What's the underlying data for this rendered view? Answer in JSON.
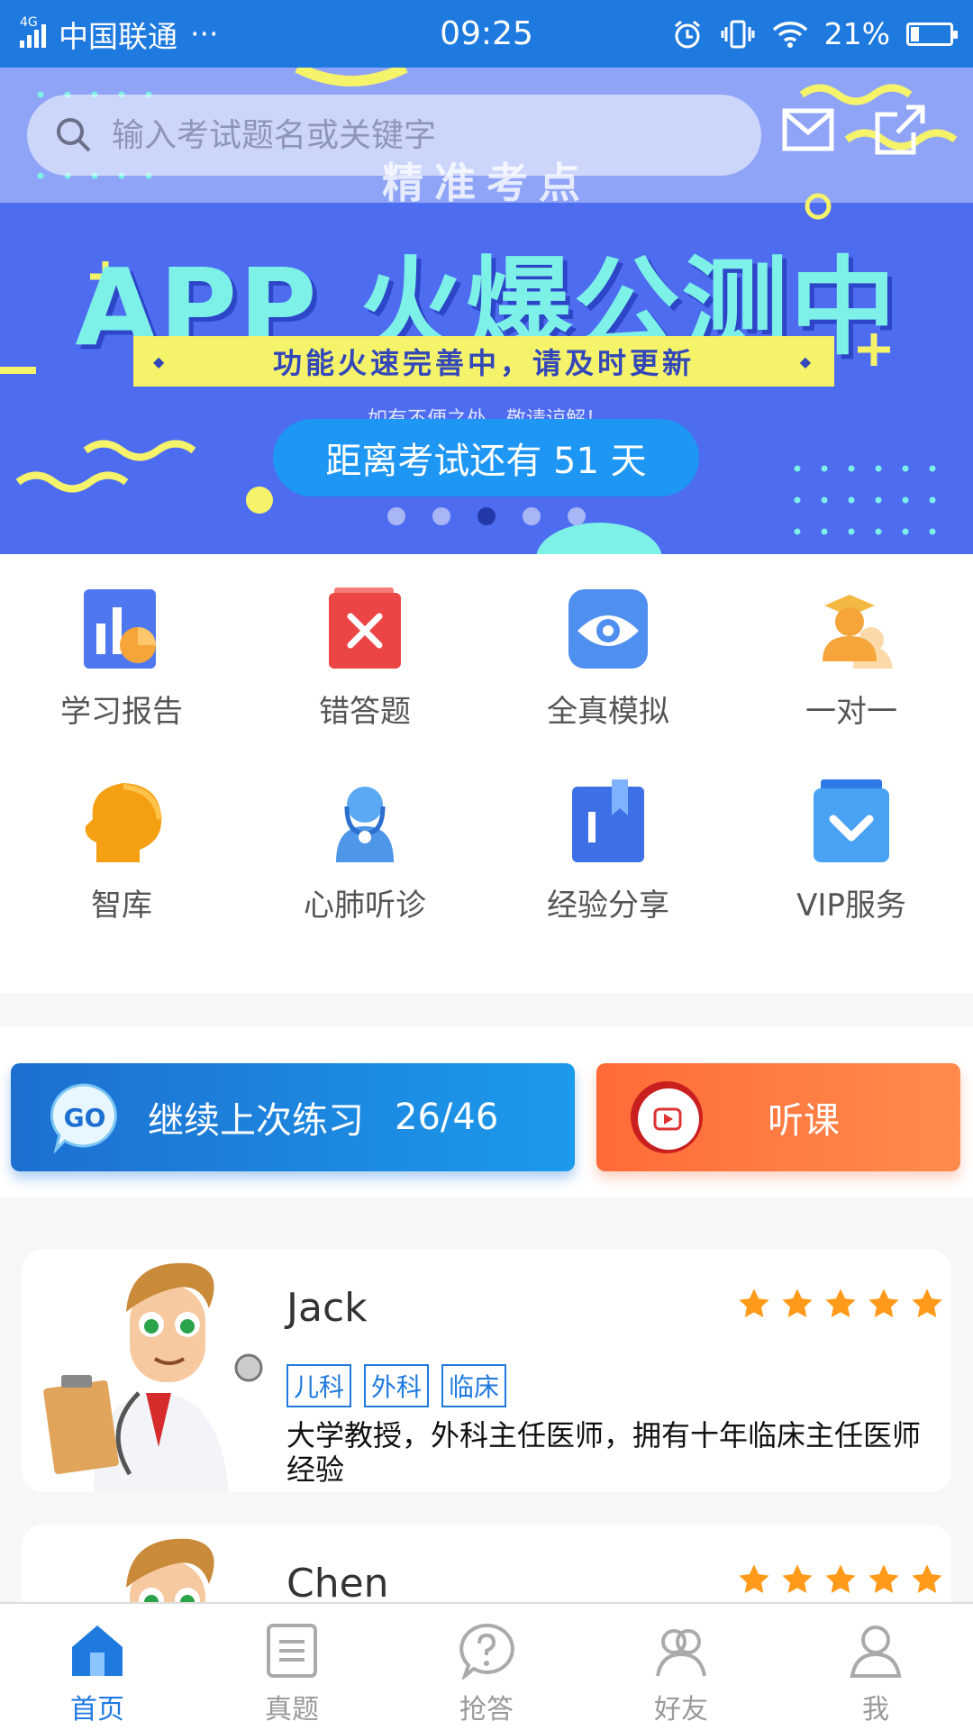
{
  "status_bar": {
    "network": "4G",
    "carrier": "中国联通",
    "more": "···",
    "time": "09:25",
    "battery": "21%",
    "battery_level": 0.21
  },
  "banner": {
    "search_placeholder": "输入考试题名或关键字",
    "top_text": "精准考点",
    "title": "APP 火爆公测中",
    "strip_text": "功能火速完善中，请及时更新",
    "note": "如有不便之处，敬请谅解！",
    "countdown": "距离考试还有  51  天",
    "slide_count": 5,
    "active_slide": 3
  },
  "features": [
    {
      "label": "学习报告",
      "icon": "report-icon"
    },
    {
      "label": "错答题",
      "icon": "wrong-answer-icon"
    },
    {
      "label": "全真模拟",
      "icon": "eye-icon"
    },
    {
      "label": "一对一",
      "icon": "tutor-icon"
    },
    {
      "label": "智库",
      "icon": "brain-icon"
    },
    {
      "label": "心肺听诊",
      "icon": "auscultation-icon"
    },
    {
      "label": "经验分享",
      "icon": "bookmark-icon"
    },
    {
      "label": "VIP服务",
      "icon": "vip-icon"
    }
  ],
  "actions": {
    "continue_label": "继续上次练习",
    "continue_progress": "26/46",
    "go_badge": "GO",
    "listen_label": "听课"
  },
  "teachers": [
    {
      "name": "Jack",
      "rating": 5,
      "tags": [
        "儿科",
        "外科",
        "临床"
      ],
      "desc": "大学教授，外科主任医师，拥有十年临床主任医师经验"
    },
    {
      "name": "Chen",
      "rating": 5,
      "tags": [],
      "desc": ""
    }
  ],
  "tabbar": [
    {
      "label": "首页",
      "icon": "home-icon",
      "active": true
    },
    {
      "label": "真题",
      "icon": "document-icon",
      "active": false
    },
    {
      "label": "抢答",
      "icon": "question-icon",
      "active": false
    },
    {
      "label": "好友",
      "icon": "friends-icon",
      "active": false
    },
    {
      "label": "我",
      "icon": "profile-icon",
      "active": false
    }
  ],
  "colors": {
    "primary": "#1f7ae0",
    "banner": "#4d6cf0",
    "accent_orange": "#ff7a40",
    "star": "#ff9a1a"
  }
}
